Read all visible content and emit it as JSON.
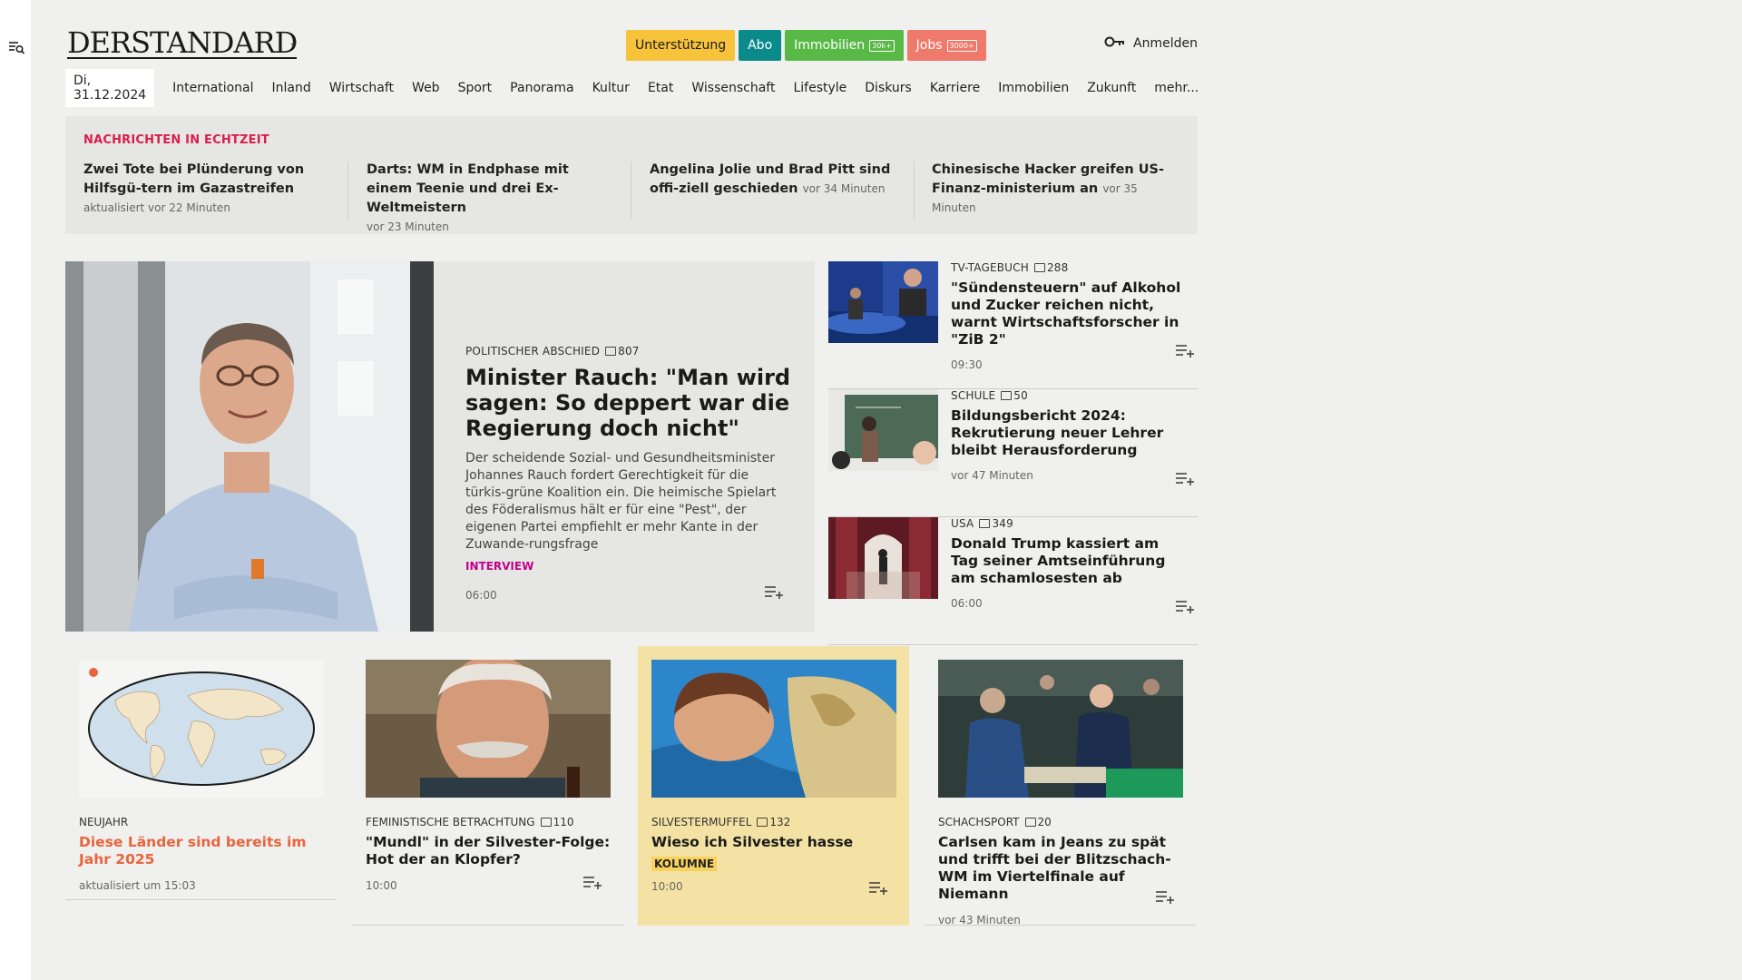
{
  "brand": {
    "logo": "DERSTANDARD"
  },
  "header": {
    "pills": [
      {
        "label": "Unterstützung",
        "bg": "#f7c33b",
        "fg": "#1a1a1a",
        "badge": ""
      },
      {
        "label": "Abo",
        "bg": "#0a8a8a",
        "fg": "#ffffff",
        "badge": ""
      },
      {
        "label": "Immobilien",
        "bg": "#58b947",
        "fg": "#ffffff",
        "badge": "30k+"
      },
      {
        "label": "Jobs",
        "bg": "#ef7a6b",
        "fg": "#ffffff",
        "badge": "3000+"
      }
    ],
    "login": "Anmelden"
  },
  "nav": {
    "date": "Di, 31.12.2024",
    "links": [
      "International",
      "Inland",
      "Wirtschaft",
      "Web",
      "Sport",
      "Panorama",
      "Kultur",
      "Etat",
      "Wissenschaft",
      "Lifestyle",
      "Diskurs",
      "Karriere",
      "Immobilien",
      "Zukunft",
      "mehr..."
    ]
  },
  "ticker": {
    "title": "NACHRICHTEN IN ECHTZEIT",
    "items": [
      {
        "title": "Zwei Tote bei Plünderung von Hilfsgü-tern im Gazastreifen",
        "meta": "aktualisiert vor 22 Minuten"
      },
      {
        "title": "Darts: WM in Endphase mit einem Teenie und drei Ex-Weltmeistern",
        "meta": "vor 23 Minuten"
      },
      {
        "title": "Angelina Jolie und Brad Pitt sind offi-ziell geschieden",
        "meta": "vor 34 Minuten"
      },
      {
        "title": "Chinesische Hacker greifen US-Finanz-ministerium an",
        "meta": "vor 35 Minuten"
      }
    ]
  },
  "hero": {
    "kicker": "POLITISCHER ABSCHIED",
    "comments": "807",
    "title": "Minister Rauch: \"Man wird sagen: So deppert war die Regierung doch nicht\"",
    "lead": "Der scheidende Sozial- und Gesundheitsminister Johannes Rauch fordert Gerechtigkeit für die türkis-grüne Koalition ein. Die heimische Spielart des Föderalismus hält er für eine \"Pest\", der eigenen Partei empfiehlt er mehr Kante in der Zuwande-rungsfrage",
    "tag": "INTERVIEW",
    "tag_color": "#c2008a",
    "time": "06:00"
  },
  "side": [
    {
      "kicker": "TV-TAGEBUCH",
      "comments": "288",
      "title": "\"Sündensteuern\" auf Alkohol und Zucker reichen nicht, warnt Wirtschaftsforscher in \"ZiB 2\"",
      "time": "09:30"
    },
    {
      "kicker": "SCHULE",
      "comments": "50",
      "title": "Bildungsbericht 2024: Rekrutierung neuer Lehrer bleibt Herausforderung",
      "time": "vor 47 Minuten"
    },
    {
      "kicker": "USA",
      "comments": "349",
      "title": "Donald Trump kassiert am Tag seiner Amtseinführung am schamlosesten ab",
      "time": "06:00"
    }
  ],
  "cards": [
    {
      "kicker": "NEUJAHR",
      "comments": "",
      "title": "Diese Länder sind bereits im Jahr 2025",
      "title_color": "#e8643c",
      "time": "aktualisiert um 15:03",
      "label": ""
    },
    {
      "kicker": "FEMINISTISCHE BETRACHTUNG",
      "comments": "110",
      "title": "\"Mundl\" in der Silvester-Folge: Hot der an Klopfer?",
      "title_color": "#1a1a1a",
      "time": "10:00",
      "label": ""
    },
    {
      "kicker": "SILVESTERMUFFEL",
      "comments": "132",
      "title": "Wieso ich Silvester hasse",
      "title_color": "#1a1a1a",
      "time": "10:00",
      "label": "KOLUMNE"
    },
    {
      "kicker": "SCHACHSPORT",
      "comments": "20",
      "title": "Carlsen kam in Jeans zu spät und trifft bei der Blitzschach-WM im Viertelfinale auf Niemann",
      "title_color": "#1a1a1a",
      "time": "vor 43 Minuten",
      "label": ""
    }
  ],
  "colors": {
    "page_bg": "#f0f0ee",
    "panel_bg": "#e6e6e4",
    "highlight_card": "#f3e2a3",
    "ticker_title": "#d91f4a"
  }
}
